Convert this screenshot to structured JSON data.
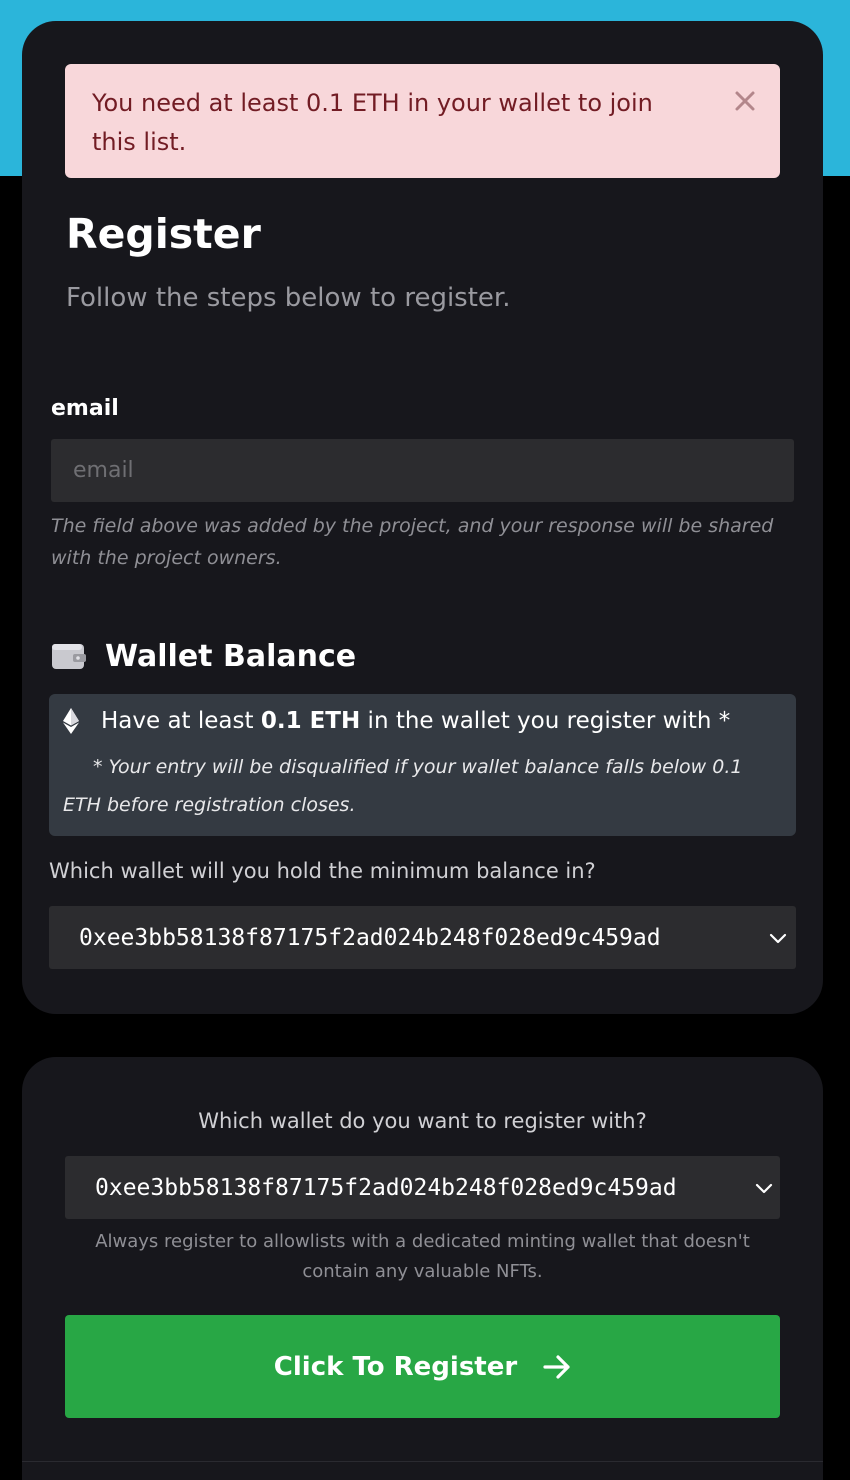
{
  "colors": {
    "top_band": "#2bb5da",
    "card_bg": "#17171c",
    "alert_bg": "#f8d7da",
    "alert_text": "#721c24",
    "input_bg": "#2c2c2f",
    "requirement_bg": "#343a42",
    "button_green": "#28a745"
  },
  "alert": {
    "message": "You need at least 0.1 ETH in your wallet to join this list.",
    "close_icon": "close-icon"
  },
  "header": {
    "title": "Register",
    "subtitle": "Follow the steps below to register."
  },
  "email_field": {
    "label": "email",
    "placeholder": "email",
    "value": "",
    "help": "The field above was added by the project, and your response will be shared with the project owners."
  },
  "wallet_balance": {
    "icon": "wallet-icon",
    "heading": "Wallet Balance",
    "requirement": {
      "icon": "ethereum-icon",
      "prefix": "Have at least ",
      "amount": "0.1 ETH",
      "suffix": " in the wallet you register with *",
      "note": "* Your entry will be disqualified if your wallet balance falls below 0.1 ETH before registration closes."
    },
    "question": "Which wallet will you hold the minimum balance in?",
    "selected_wallet": "0xee3bb58138f87175f2ad024b248f028ed9c459ad"
  },
  "registration": {
    "question": "Which wallet do you want to register with?",
    "selected_wallet": "0xee3bb58138f87175f2ad024b248f028ed9c459ad",
    "note": "Always register to allowlists with a dedicated minting wallet that doesn't contain any valuable NFTs.",
    "button_label": "Click To Register",
    "button_icon": "arrow-right-icon"
  }
}
